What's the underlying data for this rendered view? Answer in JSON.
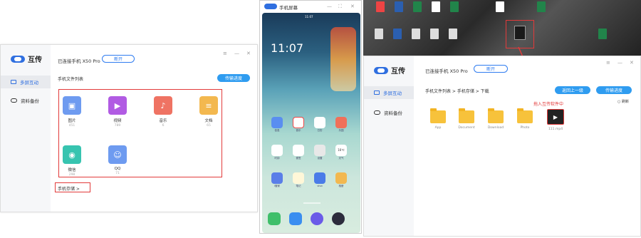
{
  "left_app": {
    "brand": "互传",
    "connected": "已连接手机 X50 Pro",
    "disconnect": "断开",
    "nav": [
      {
        "label": "多屏互动"
      },
      {
        "label": "资料备份"
      }
    ],
    "section_title": "手机文件列表",
    "action": "传输进度",
    "controls": {
      "menu": "≡",
      "minimize": "—",
      "close": "✕"
    },
    "categories": [
      {
        "name": "图片",
        "count": "451",
        "color": "#6e9bf0",
        "icon": "image-icon"
      },
      {
        "name": "视频",
        "count": "789",
        "color": "#b15be3",
        "icon": "video-icon"
      },
      {
        "name": "音乐",
        "count": "6",
        "color": "#ef7363",
        "icon": "music-icon"
      },
      {
        "name": "文档",
        "count": "65",
        "color": "#f3b84f",
        "icon": "document-icon"
      },
      {
        "name": "微信",
        "count": "298",
        "color": "#37c4b0",
        "icon": "wechat-icon"
      },
      {
        "name": "QQ",
        "count": "71",
        "color": "#6e9bf0",
        "icon": "qq-icon"
      }
    ],
    "phone_storage": "手机存储 >"
  },
  "phone_window": {
    "title": "手机屏幕",
    "controls": {
      "minimize": "—",
      "fullscreen": "⛶",
      "close": "✕"
    },
    "status_time": "11:07",
    "clock": "11:07",
    "apps": [
      "信息",
      "音乐",
      "日历",
      "乐园",
      "时钟",
      "便签",
      "设置",
      "天气",
      "i管家",
      "笔记",
      "vivo",
      "相册"
    ],
    "dock": [
      "电话",
      "消息",
      "浏览器",
      "相机"
    ],
    "weather": "16℃"
  },
  "right_app": {
    "brand": "互传",
    "connected": "已连接手机 X50 Pro",
    "disconnect": "断开",
    "nav": [
      {
        "label": "多屏互动"
      },
      {
        "label": "资料备份"
      }
    ],
    "breadcrumb": "手机文件列表 > 手机存储 > 下载",
    "back": "返回上一级",
    "action": "传输进度",
    "refresh": "刷新",
    "controls": {
      "menu": "≡",
      "minimize": "—",
      "close": "✕"
    },
    "folders": [
      "App",
      "Document",
      "Download",
      "Photo"
    ],
    "file": "111.mp4",
    "annotation": "拖入互传软件中"
  }
}
